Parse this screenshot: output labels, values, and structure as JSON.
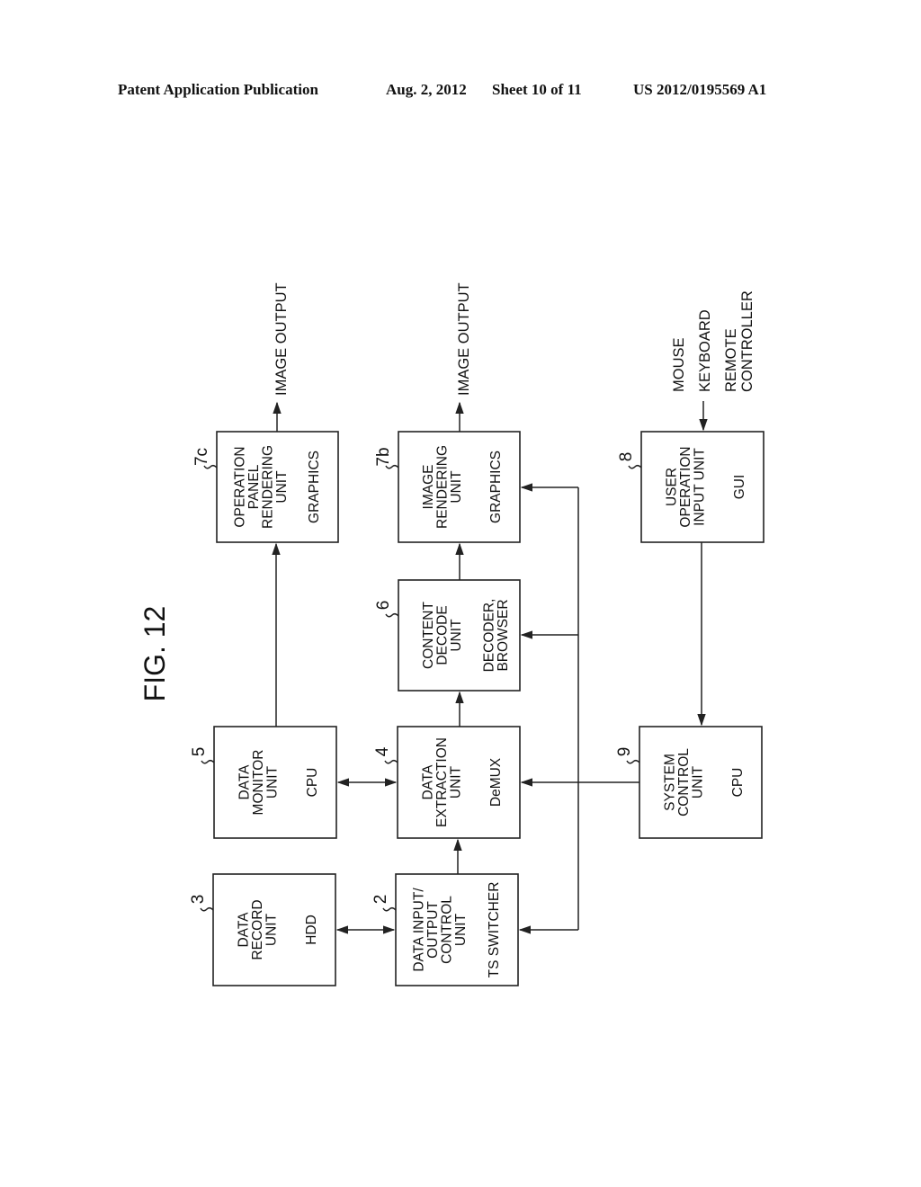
{
  "header": {
    "publication": "Patent Application Publication",
    "date": "Aug. 2, 2012",
    "sheet": "Sheet 10 of 11",
    "number": "US 2012/0195569 A1"
  },
  "figure": {
    "title": "FIG. 12",
    "outputs": {
      "out_7c": "IMAGE OUTPUT",
      "out_7b": "IMAGE OUTPUT"
    },
    "inputs": [
      "MOUSE",
      "KEYBOARD",
      "REMOTE",
      "CONTROLLER"
    ],
    "blocks": {
      "b7c": {
        "ref": "7c",
        "lines": [
          "OPERATION",
          "PANEL",
          "RENDERING",
          "UNIT"
        ],
        "sub": [
          "GRAPHICS"
        ]
      },
      "b7b": {
        "ref": "7b",
        "lines": [
          "IMAGE",
          "RENDERING",
          "UNIT"
        ],
        "sub": [
          "GRAPHICS"
        ]
      },
      "b8": {
        "ref": "8",
        "lines": [
          "USER",
          "OPERATION",
          "INPUT UNIT"
        ],
        "sub": [
          "GUI"
        ]
      },
      "b6": {
        "ref": "6",
        "lines": [
          "CONTENT",
          "DECODE",
          "UNIT"
        ],
        "sub": [
          "DECODER,",
          "BROWSER"
        ]
      },
      "b5": {
        "ref": "5",
        "lines": [
          "DATA",
          "MONITOR",
          "UNIT"
        ],
        "sub": [
          "CPU"
        ]
      },
      "b4": {
        "ref": "4",
        "lines": [
          "DATA",
          "EXTRACTION",
          "UNIT"
        ],
        "sub": [
          "DeMUX"
        ]
      },
      "b9": {
        "ref": "9",
        "lines": [
          "SYSTEM",
          "CONTROL",
          "UNIT"
        ],
        "sub": [
          "CPU"
        ]
      },
      "b3": {
        "ref": "3",
        "lines": [
          "DATA",
          "RECORD",
          "UNIT"
        ],
        "sub": [
          "HDD"
        ]
      },
      "b2": {
        "ref": "2",
        "lines": [
          "DATA INPUT/",
          "OUTPUT",
          "CONTROL",
          "UNIT"
        ],
        "sub": [
          "TS SWITCHER"
        ]
      }
    }
  }
}
